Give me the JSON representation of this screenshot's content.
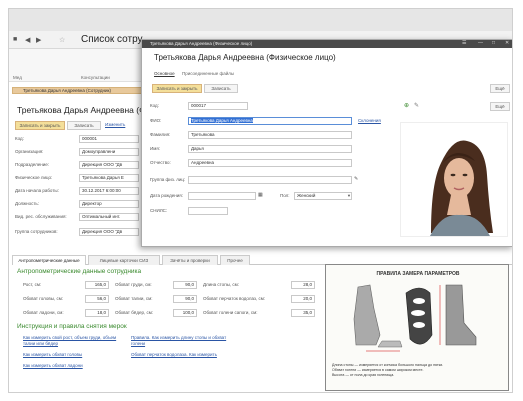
{
  "app": {
    "title": "Список сотру",
    "toolbar_labels": [
      "Мед",
      "Консультации"
    ]
  },
  "list_header": "Третьякова Дарья Андреевна (Сотрудник)",
  "employee": {
    "title": "Третьякова Дарья Андреевна (Ф",
    "save_button": "Записать и закрыть",
    "write_button": "Записать",
    "edit_link": "Изменить",
    "fields": [
      {
        "label": "Код:",
        "value": "000001"
      },
      {
        "label": "Организация:",
        "value": "Домоуправлени"
      },
      {
        "label": "Подразделение:",
        "value": "Дирекция ООО \"Дв"
      },
      {
        "label": "Физическое лицо:",
        "value": "Третьякова Дарья Е"
      },
      {
        "label": "Дата начала работы:",
        "value": "30.12.2017  6:00:00"
      },
      {
        "label": "Должность:",
        "value": "Директор"
      },
      {
        "label": "Вид. рес. обслуживания:",
        "value": "Оптимальный инт."
      },
      {
        "label": "Группа сотрудников:",
        "value": "Дирекция ООО \"Дв"
      }
    ]
  },
  "tabs": [
    "Антропометрические данные",
    "Лицевые карточки СИЗ",
    "Зачёты и проверки",
    "Прочее"
  ],
  "anthropometry": {
    "header": "Антропометрические данные сотрудника",
    "rows": [
      [
        {
          "label": "Рост, см:",
          "value": "165,0"
        },
        {
          "label": "Обхват груди, см:",
          "value": "90,0"
        },
        {
          "label": "Длина стопы, см:",
          "value": "28,0"
        }
      ],
      [
        {
          "label": "Обхват головы, см:",
          "value": "56,0"
        },
        {
          "label": "Обхват талии, см:",
          "value": "90,0"
        },
        {
          "label": "Обхват перчаток водолаз, см:",
          "value": "20,0"
        }
      ],
      [
        {
          "label": "Обхват ладони, см:",
          "value": "18,0"
        },
        {
          "label": "Обхват бёдер, см:",
          "value": "100,0"
        },
        {
          "label": "Обхват голени сапоги, см:",
          "value": "35,0"
        }
      ]
    ]
  },
  "instructions": {
    "header": "Инструкция и правила снятия мерок",
    "links": [
      "Как измерить свой рост, объем груди, объем талии или бёдер",
      "Как измерить обхват головы",
      "Как измерить обхват ладони",
      "Правила. Как измерить длину стопы и обхват голени",
      "Обхват перчаток водолаза. Как измерить"
    ]
  },
  "modal": {
    "window_title": "Третьякова Дарья Андреевна (Физическое лицо)",
    "title": "Третьякова Дарья Андреевна (Физическое лицо)",
    "nav": [
      "Основное",
      "Присоединенные файлы"
    ],
    "save_button": "Записать и закрыть",
    "write_button": "Записать",
    "more_button": "Ещё",
    "more_button_2": "Ещё",
    "fields": [
      {
        "label": "Код:",
        "value": "000017"
      },
      {
        "label": "ФИО:",
        "value": "Третьякова Дарья Андреевна"
      },
      {
        "label": "Фамилия:",
        "value": "Третьякова"
      },
      {
        "label": "Имя:",
        "value": "Дарья"
      },
      {
        "label": "Отчество:",
        "value": "Андреевна"
      },
      {
        "label": "Группа физ. лиц:",
        "value": ""
      },
      {
        "label": "Дата рождения:",
        "value": ""
      },
      {
        "label": "СНИЛС:",
        "value": ""
      }
    ],
    "gender_label": "Пол:",
    "gender_value": "Женский",
    "fio_link": "Склонения"
  },
  "foot_chart": {
    "title": "ПРАВИЛА ЗАМЕРА ПАРАМЕТРОВ",
    "notes": [
      "Длина стопы — измеряется от кончика большого пальца до пятки.",
      "Обхват голени — измеряется в самом широком месте.",
      "Высота — от пола до края голенища."
    ]
  },
  "colors": {
    "accent_button": "#f4df9a",
    "link": "#2a55a5",
    "section_header": "#3a8a2e",
    "list_header": "#e8c99c"
  }
}
